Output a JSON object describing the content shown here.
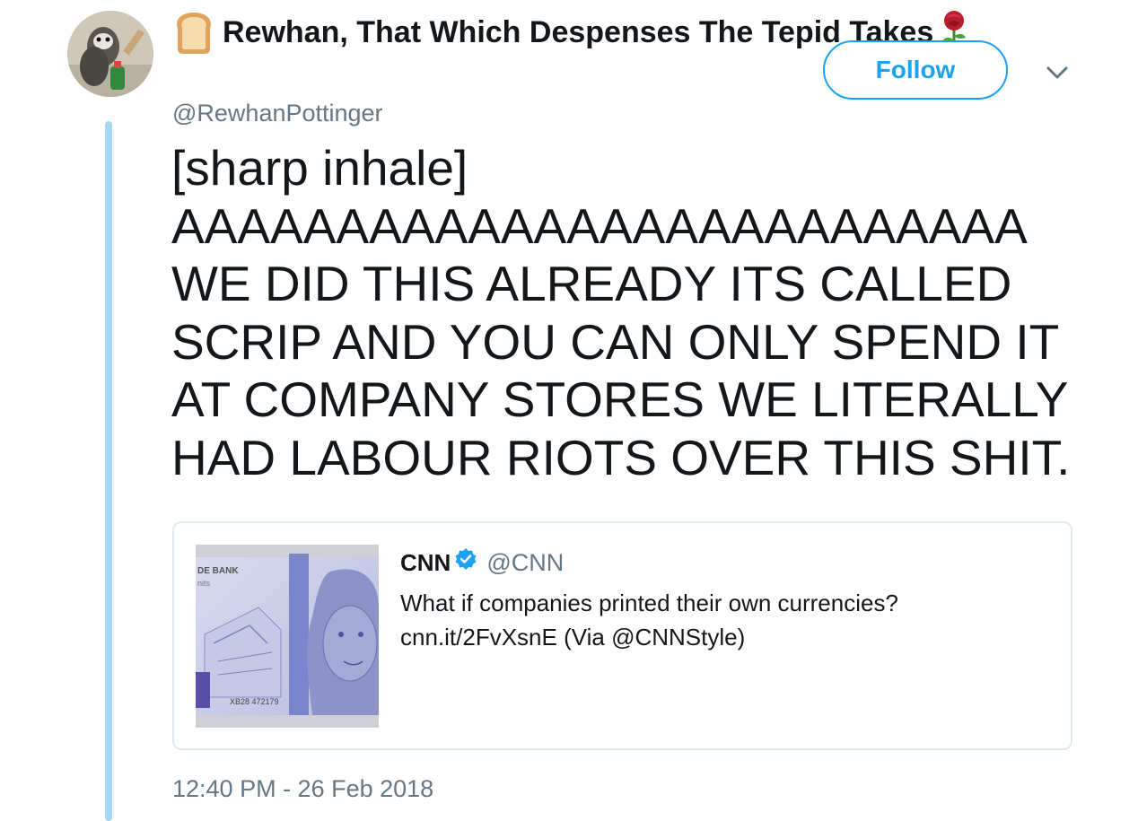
{
  "author": {
    "display_name": "Rewhan, That Which Despenses The Tepid Takes",
    "handle": "@RewhanPottinger",
    "name_emoji_left": "bread-icon",
    "name_emoji_right": "rose-icon"
  },
  "header": {
    "follow_label": "Follow",
    "more_icon": "chevron-down-icon"
  },
  "tweet": {
    "text_lines": [
      "[sharp inhale]",
      "AAAAAAAAAAAAAAAAAAAAAAAAAA",
      "WE DID THIS ALREADY ITS CALLED",
      "SCRIP AND YOU CAN ONLY SPEND IT",
      "AT COMPANY STORES WE LITERALLY",
      "HAD LABOUR RIOTS OVER THIS SHIT."
    ],
    "timestamp": "12:40 PM - 26 Feb 2018"
  },
  "quoted_tweet": {
    "name": "CNN",
    "verified": true,
    "handle": "@CNN",
    "text_lines": [
      "What if companies printed their own currencies?",
      "cnn.it/2FvXsnE (Via @CNNStyle)"
    ],
    "thumbnail": {
      "bank_text": "DE BANK",
      "bank_sub": "nits",
      "serial": "XB28 472179"
    }
  },
  "colors": {
    "accent": "#1da1f2",
    "thread_line": "#a6d8f6",
    "muted_text": "#657786",
    "border": "#e1e8ed"
  }
}
